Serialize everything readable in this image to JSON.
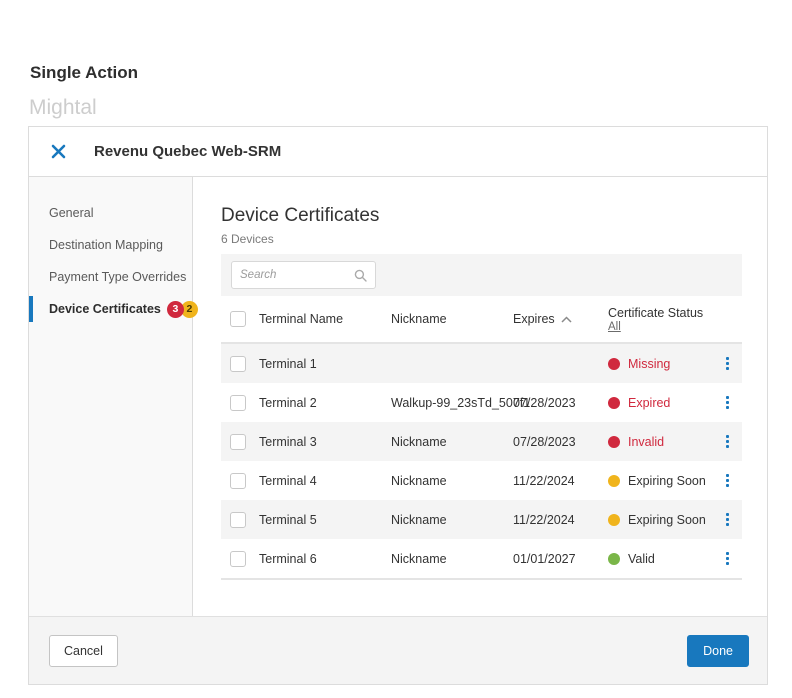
{
  "page": {
    "title": "Single Action",
    "subtitle": "Mightal"
  },
  "colors": {
    "accent_blue": "#1878be",
    "status_red": "#d0293e",
    "status_amber": "#f0b41c",
    "status_green": "#7ab648",
    "dark_text": "#333333"
  },
  "modal": {
    "title": "Revenu Quebec Web-SRM",
    "sidebar": {
      "items": [
        {
          "label": "General"
        },
        {
          "label": "Destination Mapping"
        },
        {
          "label": "Payment Type Overrides"
        },
        {
          "label": "Device Certificates"
        }
      ],
      "active_item": "Device Certificates",
      "badges": {
        "red_count": "3",
        "amber_count": "2",
        "red_color": "#d0293e",
        "amber_color": "#f0b41c"
      }
    },
    "content": {
      "heading": "Device Certificates",
      "subheading": "6 Devices",
      "search": {
        "placeholder": "Search"
      },
      "table": {
        "columns": {
          "name": "Terminal Name",
          "nickname": "Nickname",
          "expires": "Expires",
          "status": "Certificate Status"
        },
        "expires_sort": "asc",
        "status_filter_label": "All",
        "rows": [
          {
            "name": "Terminal 1",
            "nickname": "",
            "expires": "",
            "status": "Missing",
            "dot_color": "#d0293e",
            "status_text_color": "#d0293e"
          },
          {
            "name": "Terminal 2",
            "nickname": "Walkup-99_23sTd_507f1",
            "expires": "07/28/2023",
            "status": "Expired",
            "dot_color": "#d0293e",
            "status_text_color": "#d0293e"
          },
          {
            "name": "Terminal 3",
            "nickname": "Nickname",
            "expires": "07/28/2023",
            "status": "Invalid",
            "dot_color": "#d0293e",
            "status_text_color": "#d0293e"
          },
          {
            "name": "Terminal 4",
            "nickname": "Nickname",
            "expires": "11/22/2024",
            "status": "Expiring Soon",
            "dot_color": "#f0b41c",
            "status_text_color": "#333333"
          },
          {
            "name": "Terminal 5",
            "nickname": "Nickname",
            "expires": "11/22/2024",
            "status": "Expiring Soon",
            "dot_color": "#f0b41c",
            "status_text_color": "#333333"
          },
          {
            "name": "Terminal 6",
            "nickname": "Nickname",
            "expires": "01/01/2027",
            "status": "Valid",
            "dot_color": "#7ab648",
            "status_text_color": "#333333"
          }
        ]
      }
    },
    "footer": {
      "cancel_label": "Cancel",
      "done_label": "Done"
    }
  }
}
